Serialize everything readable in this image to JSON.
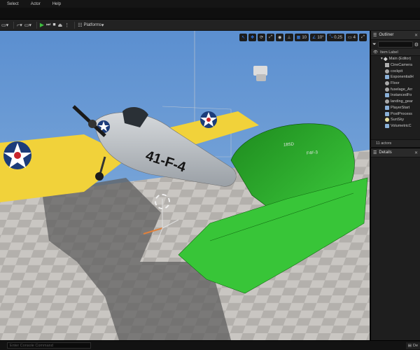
{
  "menu": {
    "items": [
      "Select",
      "Actor",
      "Help"
    ]
  },
  "toolbar": {
    "platforms_label": "Platforms"
  },
  "viewport": {
    "grid_snap": "10",
    "rotation_snap": "10°",
    "scale_snap": "0.25",
    "camera_speed": "4",
    "aircraft_fuselage_code": "41-F-4",
    "tail_code_left": "18SD",
    "tail_code_right": "F4F-3"
  },
  "outliner": {
    "title": "Outliner",
    "column_header": "Item Label",
    "items": [
      {
        "label": "Main (Editor)",
        "indent": 0,
        "icon": "world-icon"
      },
      {
        "label": "CineCamera",
        "indent": 1,
        "icon": "camera-icon"
      },
      {
        "label": "cockpit",
        "indent": 1,
        "icon": "mesh-icon"
      },
      {
        "label": "ExponentialH",
        "indent": 1,
        "icon": "actor-icon"
      },
      {
        "label": "Floor",
        "indent": 1,
        "icon": "mesh-icon"
      },
      {
        "label": "fuselage_Arr",
        "indent": 1,
        "icon": "mesh-icon"
      },
      {
        "label": "InstancedFo",
        "indent": 1,
        "icon": "actor-icon"
      },
      {
        "label": "landing_gear",
        "indent": 1,
        "icon": "mesh-icon"
      },
      {
        "label": "PlayerStart",
        "indent": 1,
        "icon": "actor-icon"
      },
      {
        "label": "PostProcess",
        "indent": 1,
        "icon": "actor-icon"
      },
      {
        "label": "SunSky",
        "indent": 1,
        "icon": "light-icon"
      },
      {
        "label": "VolumetricC",
        "indent": 1,
        "icon": "actor-icon"
      }
    ],
    "actor_count": "11 actors"
  },
  "details": {
    "title": "Details"
  },
  "console": {
    "placeholder": "Enter Console Command"
  },
  "statusbar": {
    "derived_label": "De"
  }
}
